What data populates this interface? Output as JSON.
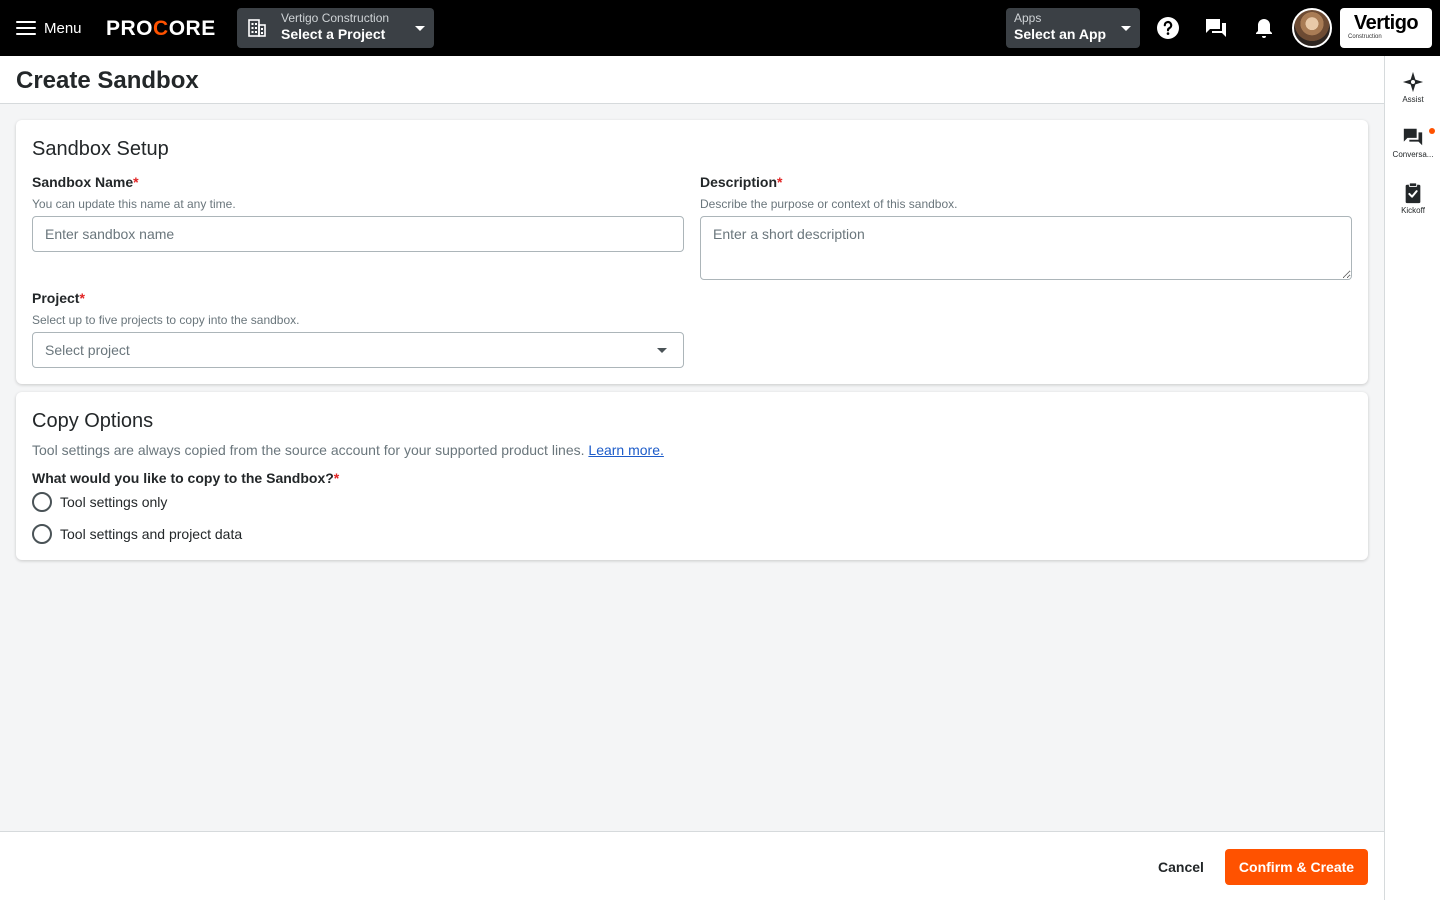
{
  "nav": {
    "menu_label": "Menu",
    "logo_text_before": "PRO",
    "logo_text_accent": "C",
    "logo_text_after": "ORE",
    "project_picker": {
      "company": "Vertigo Construction",
      "label": "Select a Project"
    },
    "app_picker": {
      "sub": "Apps",
      "label": "Select an App"
    },
    "brand": {
      "name": "Vertigo",
      "sub": "Construction"
    },
    "icons": [
      "help-icon",
      "conversations-icon",
      "notifications-icon"
    ],
    "brand_color": "#ff5200"
  },
  "header": {
    "title": "Create Sandbox"
  },
  "right_rail": {
    "items": [
      {
        "label": "Assist",
        "icon": "sparkle-icon"
      },
      {
        "label": "Conversa...",
        "icon": "chat-icon",
        "has_notification": true
      },
      {
        "label": "Kickoff",
        "icon": "clipboard-check-icon"
      }
    ]
  },
  "setup": {
    "title": "Sandbox Setup",
    "name_field": {
      "label": "Sandbox Name",
      "required_mark": "*",
      "help": "You can update this name at any time.",
      "placeholder": "Enter sandbox name",
      "value": ""
    },
    "description_field": {
      "label": "Description",
      "required_mark": "*",
      "help": "Describe the purpose or context of this sandbox.",
      "placeholder": "Enter a short description",
      "value": ""
    },
    "project_field": {
      "label": "Project",
      "required_mark": "*",
      "help": "Select up to five projects to copy into the sandbox.",
      "placeholder": "Select project"
    }
  },
  "copy_options": {
    "title": "Copy Options",
    "info": "Tool settings are always copied from the source account for your supported product lines.",
    "learn_more": "Learn more.",
    "question": "What would you like to copy to the Sandbox?",
    "required_mark": "*",
    "options": [
      "Tool settings only",
      "Tool settings and project data"
    ]
  },
  "footer": {
    "cancel_label": "Cancel",
    "confirm_label": "Confirm & Create"
  }
}
